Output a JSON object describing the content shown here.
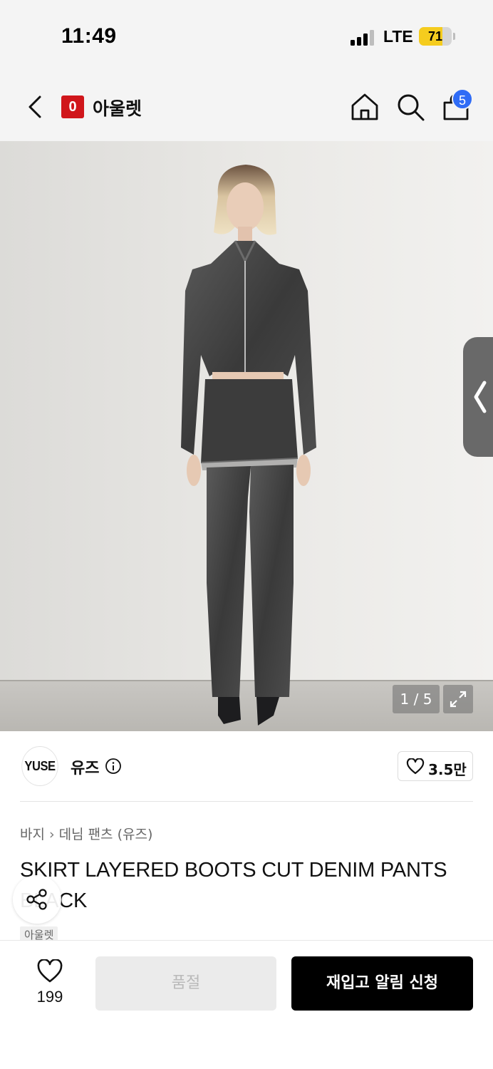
{
  "status_bar": {
    "time": "11:49",
    "network": "LTE",
    "battery_percent": 71,
    "battery_label": "71"
  },
  "header": {
    "brand_logo_letter": "0",
    "title": "아울렛",
    "cart_badge": "5",
    "icons": [
      "chevron-left-icon",
      "home-icon",
      "search-icon",
      "shopping-bag-icon"
    ]
  },
  "gallery": {
    "pager": "1 / 5",
    "current_image": 1,
    "total_images": 5
  },
  "brand": {
    "logo_text": "YUSE",
    "name": "유즈",
    "likes": "3.5만"
  },
  "breadcrumb": {
    "category": "바지",
    "subcategory": "데님 팬츠 (유즈)"
  },
  "product": {
    "title": "SKIRT LAYERED BOOTS CUT DENIM PANTS BLACK",
    "store_tag": "아울렛"
  },
  "bottom_bar": {
    "wish_count": "199",
    "soldout_label": "품절",
    "restock_label": "재입고 알림 신청"
  },
  "colors": {
    "brand_red": "#d0161b",
    "badge_blue": "#2f6cf6",
    "battery_yellow": "#f5cc1e",
    "cta_black": "#000000",
    "disabled_gray": "#ebebeb"
  }
}
